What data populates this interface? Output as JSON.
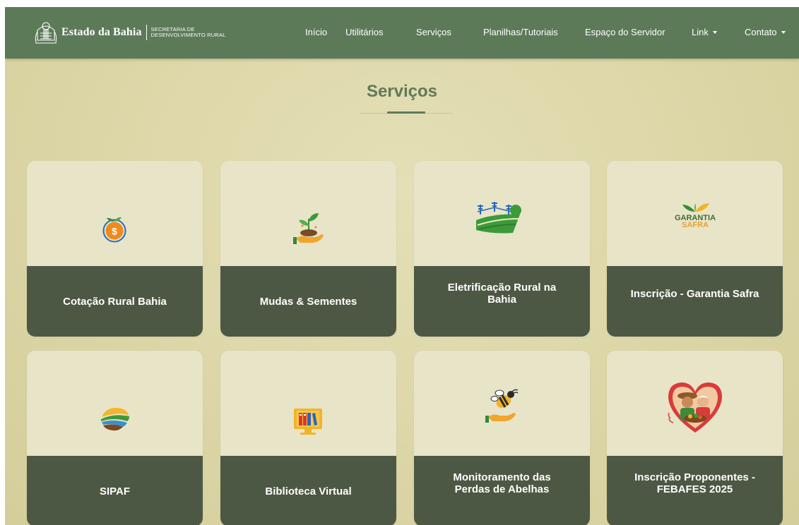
{
  "header": {
    "brand_name": "Estado da Bahia",
    "brand_sub_line1": "SECRETARIA DE",
    "brand_sub_line2": "DESENVOLVIMENTO RURAL",
    "nav": [
      {
        "label": "Início",
        "dropdown": false
      },
      {
        "label": "Utilitários",
        "dropdown": false
      },
      {
        "label": "Serviços",
        "dropdown": false
      },
      {
        "label": "Planilhas/Tutoriais",
        "dropdown": false
      },
      {
        "label": "Espaço do Servidor",
        "dropdown": false
      },
      {
        "label": "Link",
        "dropdown": true
      },
      {
        "label": "Contato",
        "dropdown": true
      }
    ]
  },
  "main": {
    "title": "Serviços",
    "cards": [
      {
        "label": "Cotação Rural Bahia",
        "icon": "money-orange-icon"
      },
      {
        "label": "Mudas & Sementes",
        "icon": "seedling-hand-icon"
      },
      {
        "label": "Eletrificação Rural na Bahia",
        "icon": "rural-electrification-icon"
      },
      {
        "label": "Inscrição - Garantia Safra",
        "icon": "garantia-safra-logo",
        "logo_text_1": "GARANTIA",
        "logo_text_2": "SAFRA"
      },
      {
        "label": "SIPAF",
        "icon": "sipaf-logo-icon"
      },
      {
        "label": "Biblioteca Virtual",
        "icon": "library-monitor-icon"
      },
      {
        "label": "Monitoramento das Perdas de Abelhas",
        "icon": "bee-hand-icon"
      },
      {
        "label": "Inscrição Proponentes - FEBAFES 2025",
        "icon": "heart-farmers-icon"
      }
    ]
  },
  "colors": {
    "navbar": "#5c7a58",
    "background": "#dcd6a7",
    "card_top": "#e8e4c8",
    "card_bottom": "#4d5844",
    "title": "#5f7a58"
  }
}
